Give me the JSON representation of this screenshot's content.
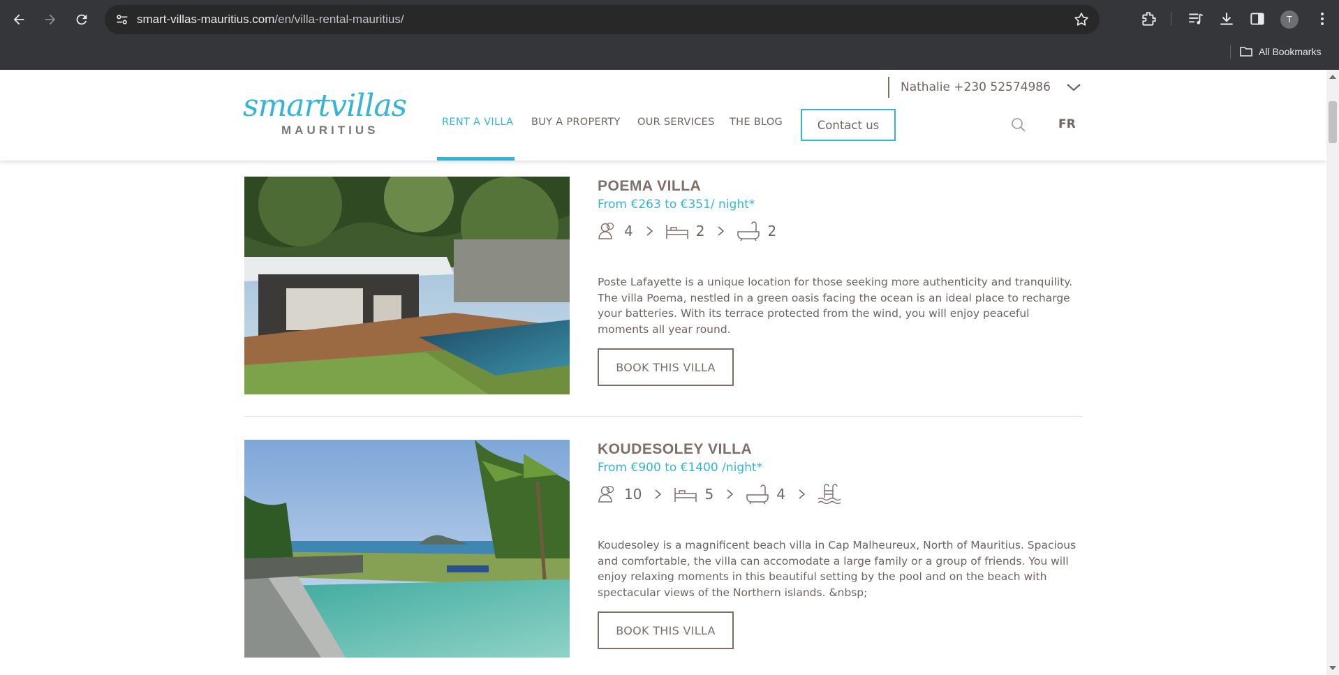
{
  "browser": {
    "url_host": "smart-villas-mauritius.com",
    "url_path": "/en/villa-rental-mauritius/",
    "profile_initial": "T",
    "bookmarks_label": "All Bookmarks"
  },
  "header": {
    "logo_script": "smartvillas",
    "logo_sub": "MAURITIUS",
    "contact_person": "Nathalie +230 52574986",
    "nav": {
      "rent": "RENT A VILLA",
      "buy": "BUY A PROPERTY",
      "services": "OUR SERVICES",
      "blog": "THE BLOG"
    },
    "contact_button": "Contact us",
    "language": "FR",
    "accent_color": "#35b4d6"
  },
  "villas": [
    {
      "title": "POEMA VILLA",
      "price": "From €263 to €351/ night*",
      "guests": "4",
      "bedrooms": "2",
      "bathrooms": "2",
      "description": "Poste Lafayette is a unique location for those seeking more authenticity and tranquility. The villa Poema, nestled in a  green oasis facing the ocean is an ideal place to recharge your batteries.  With its terrace protected from the wind, you will enjoy peaceful moments all year round.",
      "button": "BOOK THIS VILLA"
    },
    {
      "title": "KOUDESOLEY VILLA",
      "price": "From €900 to €1400 /night*",
      "guests": "10",
      "bedrooms": "5",
      "bathrooms": "4",
      "description": "Koudesoley is a magnificent beach villa in Cap Malheureux, North of Mauritius. Spacious and comfortable, the villa can accomodate a large family or a group of friends.  You will enjoy relaxing moments in this beautiful setting by the pool and on the beach with spectacular views of the Northern islands. &nbsp;",
      "button": "BOOK THIS VILLA"
    }
  ]
}
